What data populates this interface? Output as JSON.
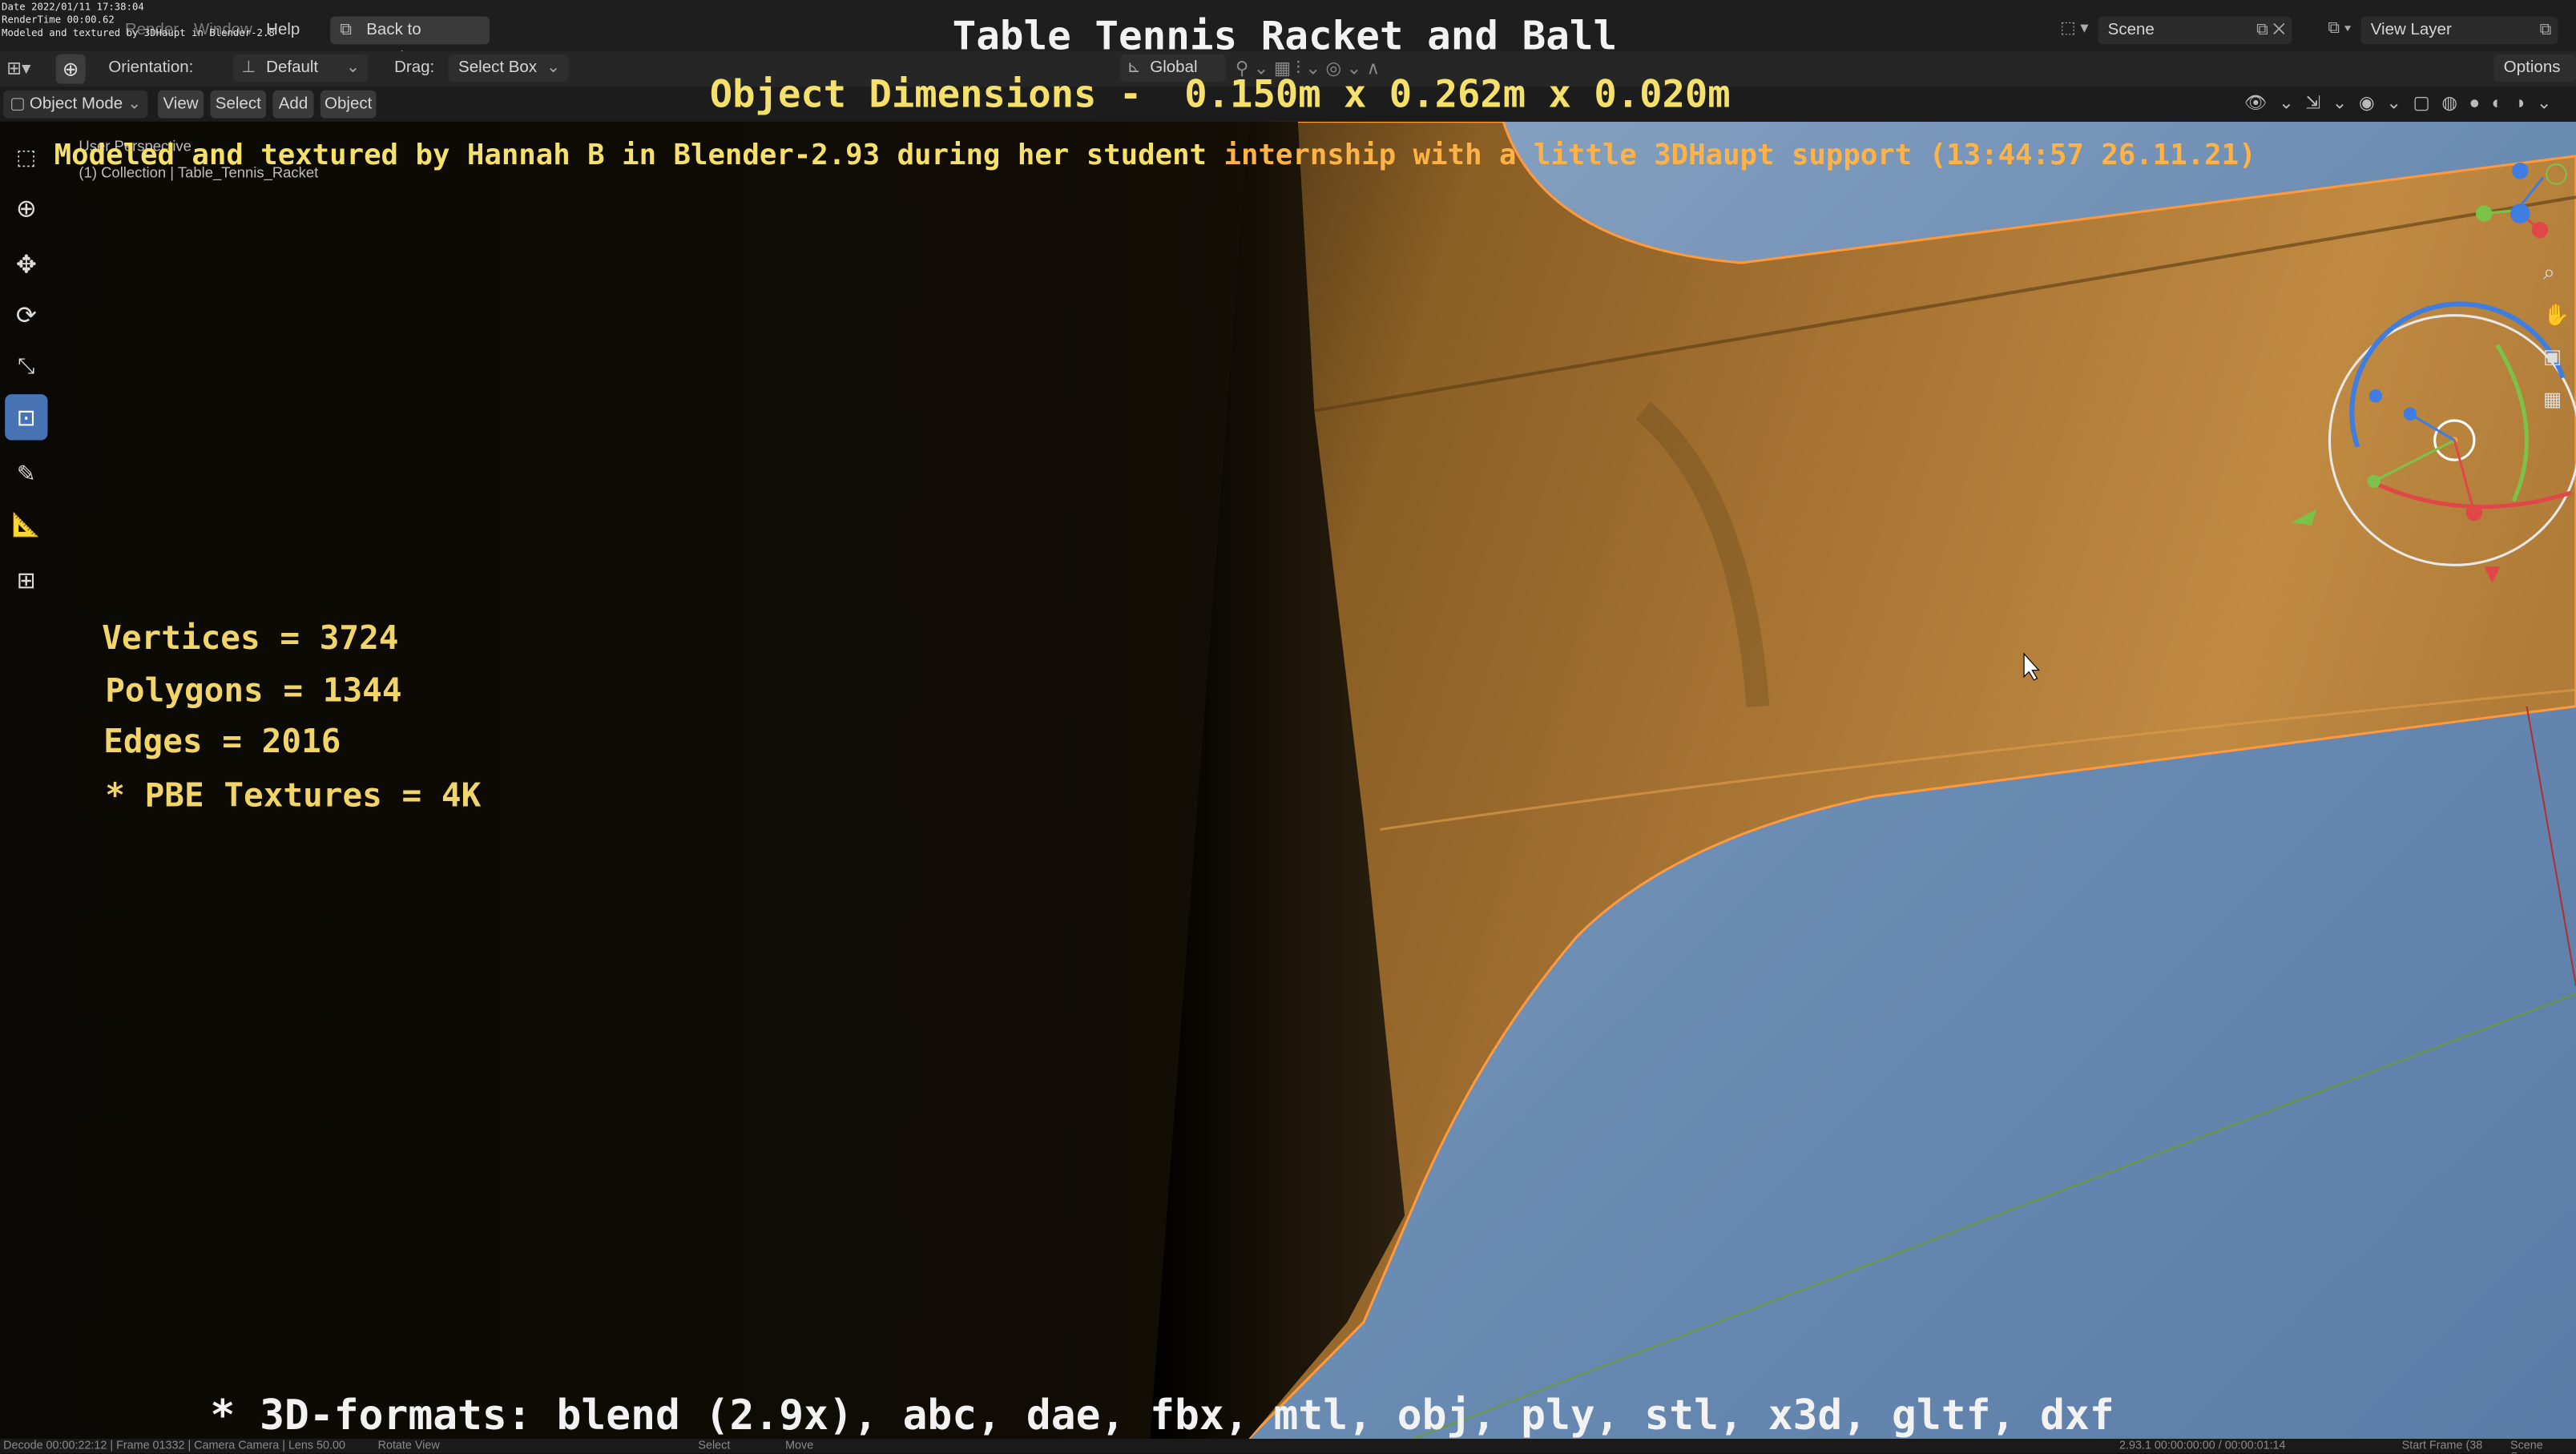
{
  "overlay": {
    "title": "Table Tennis Racket and Ball",
    "dimensions_label": "Object Dimensions -",
    "dimensions_value": "0.150m x 0.262m x 0.020m",
    "credit_prefix": "Modeled and textured by Hannah B in Blender-2.93 during her student",
    "credit_suffix": "internship with a little 3DHaupt support (13:44:57 26.11.21)",
    "stats": {
      "vertices": "Vertices = 3724",
      "polygons": "Polygons = 1344",
      "edges": "Edges = 2016",
      "textures": "* PBE Textures = 4K"
    },
    "formats": "* 3D-formats: blend (2.9x), abc, dae, fbx, mtl, obj, ply, stl, x3d, gltf, dxf",
    "render_info": {
      "date": "Date 2022/01/11 17:38:04",
      "render_time": "RenderTime 00:00.62",
      "note": "Modeled and textured by 3DHaupt in Blender-2.8"
    }
  },
  "topbar": {
    "menus": [
      "Render",
      "Window",
      "Help"
    ],
    "back_button": "Back to Previous",
    "scene_label": "Scene",
    "view_layer_label": "View Layer"
  },
  "toolbar": {
    "orientation_label": "Orientation:",
    "orientation_value": "Default",
    "drag_label": "Drag:",
    "drag_value": "Select Box",
    "transform_orientation": "Global",
    "options_label": "Options"
  },
  "header": {
    "mode": "Object Mode",
    "menus": [
      "View",
      "Select",
      "Add",
      "Object"
    ]
  },
  "viewport": {
    "perspective_label": "User Perspective",
    "collection_label": "(1) Collection | Table_Tennis_Racket"
  },
  "status": {
    "left": "Decode 00:00:22:12 | Frame 01332 | Camera Camera | Lens 50.00",
    "rotate": "Rotate View",
    "select": "Select",
    "move": "Move",
    "version": "2.93.1 00:00:00:00 / 00:00:01:14",
    "start_frame": "Start Frame (38",
    "scene": "Scene Scene"
  },
  "colors": {
    "accent": "#4772b3",
    "overlay_yellow": "#f4e06a",
    "overlay_white": "#f2f2f2",
    "overlay_orange": "#ffb347",
    "sky": "#6b8db5",
    "wood": "#9a6a2c",
    "selection_outline": "#ff9a3c"
  }
}
